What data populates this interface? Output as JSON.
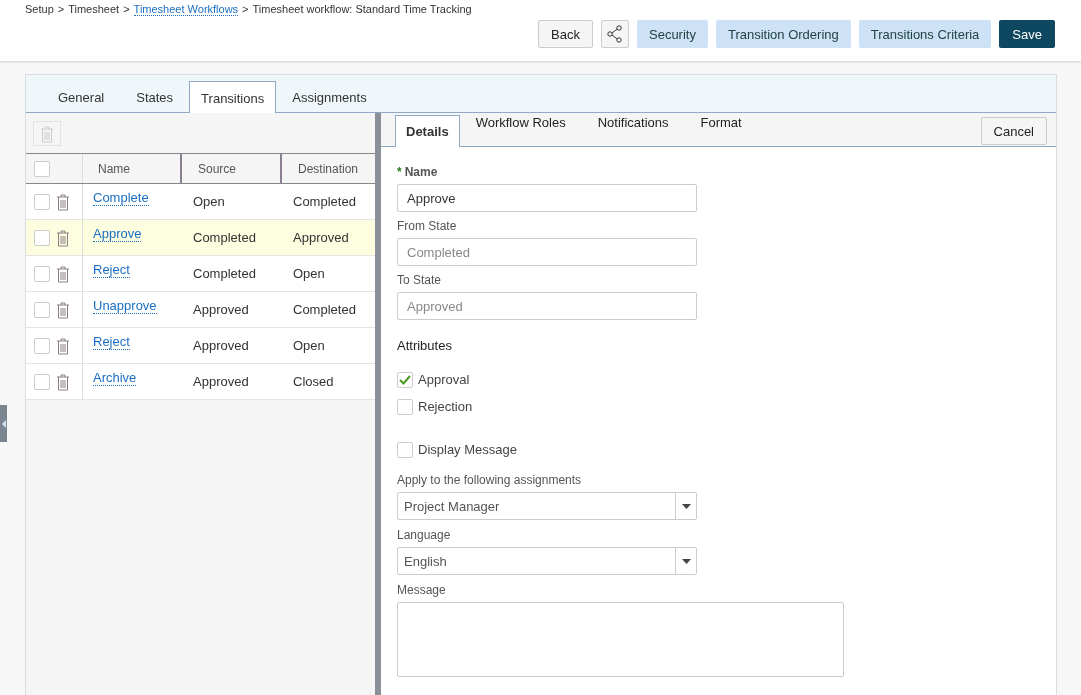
{
  "breadcrumb": [
    {
      "label": "Setup",
      "link": false
    },
    {
      "label": "Timesheet",
      "link": false
    },
    {
      "label": "Timesheet Workflows",
      "link": true
    },
    {
      "label": "Timesheet workflow: Standard Time Tracking",
      "link": false
    }
  ],
  "breadcrumb_separator": ">",
  "toolbar": [
    {
      "kind": "default",
      "label": "Back"
    },
    {
      "kind": "share"
    },
    {
      "kind": "secondary",
      "label": "Security"
    },
    {
      "kind": "secondary",
      "label": "Transition Ordering"
    },
    {
      "kind": "secondary",
      "label": "Transitions Criteria"
    },
    {
      "kind": "primary",
      "label": "Save"
    }
  ],
  "tabs": [
    {
      "label": "General",
      "selected": false
    },
    {
      "label": "States",
      "selected": false
    },
    {
      "label": "Transitions",
      "selected": true
    },
    {
      "label": "Assignments",
      "selected": false
    }
  ],
  "table": {
    "select_all": {
      "checked": false
    },
    "columns": [
      "Name",
      "Source",
      "Destination"
    ],
    "rows": [
      {
        "name": "Complete",
        "source": "Open",
        "destination": "Completed",
        "selected": false,
        "checked": false
      },
      {
        "name": "Approve",
        "source": "Completed",
        "destination": "Approved",
        "selected": true,
        "checked": false
      },
      {
        "name": "Reject",
        "source": "Completed",
        "destination": "Open",
        "selected": false,
        "checked": false
      },
      {
        "name": "Unapprove",
        "source": "Approved",
        "destination": "Completed",
        "selected": false,
        "checked": false
      },
      {
        "name": "Reject",
        "source": "Approved",
        "destination": "Open",
        "selected": false,
        "checked": false
      },
      {
        "name": "Archive",
        "source": "Approved",
        "destination": "Closed",
        "selected": false,
        "checked": false
      }
    ]
  },
  "detail_tabs": [
    {
      "label": "Details",
      "selected": true
    },
    {
      "label": "Workflow Roles",
      "selected": false
    },
    {
      "label": "Notifications",
      "selected": false
    },
    {
      "label": "Format",
      "selected": false
    }
  ],
  "cancel_button": "Cancel",
  "form": {
    "fields": [
      {
        "label": "Name",
        "required_marker": "*",
        "value": "Approve",
        "disabled": false
      },
      {
        "label": "From State",
        "value": "Completed",
        "disabled": true
      },
      {
        "label": "To State",
        "value": "Approved",
        "disabled": true
      }
    ],
    "attributes_heading": "Attributes",
    "attributes": [
      {
        "label": "Approval",
        "checked": true
      },
      {
        "label": "Rejection",
        "checked": false
      }
    ],
    "display_message": {
      "label": "Display Message",
      "checked": false
    },
    "selects": [
      {
        "label": "Apply to the following assignments",
        "value": "Project Manager"
      },
      {
        "label": "Language",
        "value": "English"
      }
    ],
    "message": {
      "label": "Message"
    }
  }
}
